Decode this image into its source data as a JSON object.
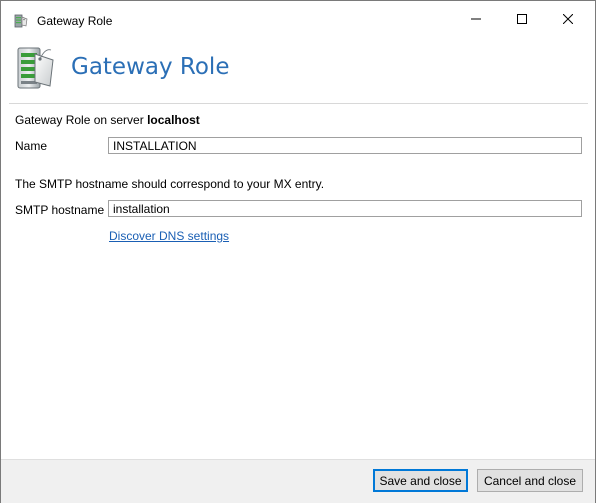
{
  "window": {
    "title": "Gateway Role",
    "controls": {
      "minimize": "minimize-icon",
      "maximize": "maximize-icon",
      "close": "close-icon"
    }
  },
  "header": {
    "title": "Gateway Role",
    "icon": "gateway-server-icon",
    "title_color": "#2b6fb6"
  },
  "intro": {
    "prefix": "Gateway Role on server ",
    "server": "localhost"
  },
  "form": {
    "name_label": "Name",
    "name_value": "INSTALLATION",
    "smtp_note": "The SMTP hostname should correspond to your MX entry.",
    "smtp_label": "SMTP hostname",
    "smtp_value": "installation",
    "discover_link": "Discover DNS settings"
  },
  "footer": {
    "save_label": "Save and close",
    "cancel_label": "Cancel and close"
  },
  "colors": {
    "accent": "#0078d7",
    "link": "#1a5fb4",
    "footer_bg": "#f0f0f0"
  }
}
